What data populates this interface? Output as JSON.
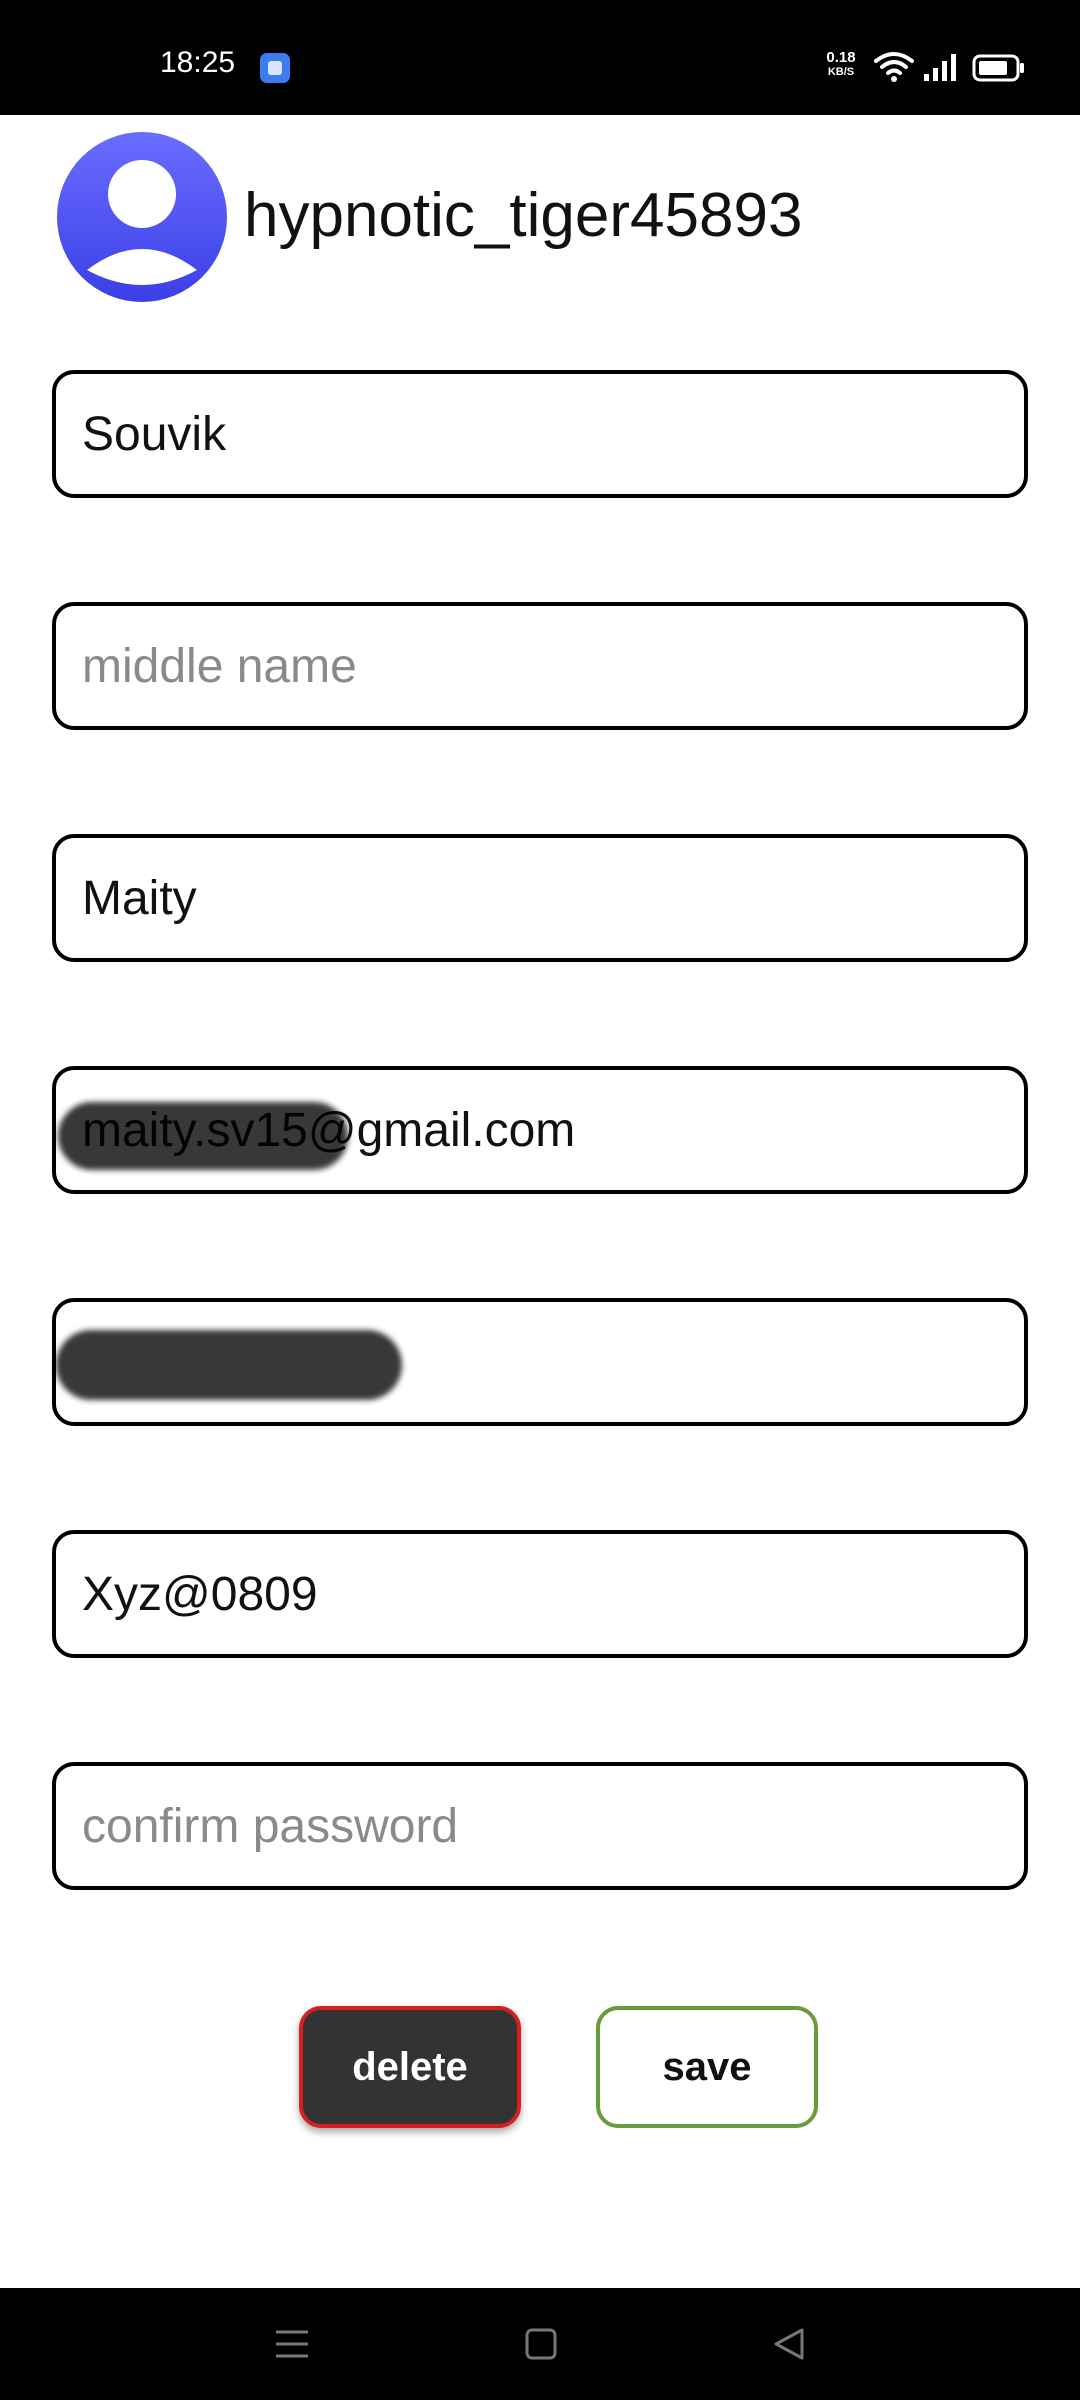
{
  "status_bar": {
    "time": "18:25",
    "net_speed_value": "0.18",
    "net_speed_unit": "KB/S",
    "icons": [
      "app-icon",
      "wifi-icon",
      "signal-icon",
      "battery-icon"
    ]
  },
  "profile": {
    "username": "hypnotic_tiger45893",
    "avatar_color": "#4b4ff0"
  },
  "form": {
    "first_name": {
      "value": "Souvik",
      "placeholder": ""
    },
    "middle_name": {
      "value": "",
      "placeholder": "middle name"
    },
    "last_name": {
      "value": "Maity",
      "placeholder": ""
    },
    "email": {
      "value": "maity.sv15@gmail.com",
      "placeholder": ""
    },
    "phone": {
      "value": "",
      "placeholder": ""
    },
    "password": {
      "value": "Xyz@0809",
      "placeholder": ""
    },
    "confirm_password": {
      "value": "",
      "placeholder": "confirm password"
    }
  },
  "actions": {
    "delete_label": "delete",
    "save_label": "save",
    "delete_border_color": "#d42020",
    "save_border_color": "#6a9a3a"
  },
  "nav_bar": {
    "icons": [
      "menu-icon",
      "home-icon",
      "back-icon"
    ]
  }
}
